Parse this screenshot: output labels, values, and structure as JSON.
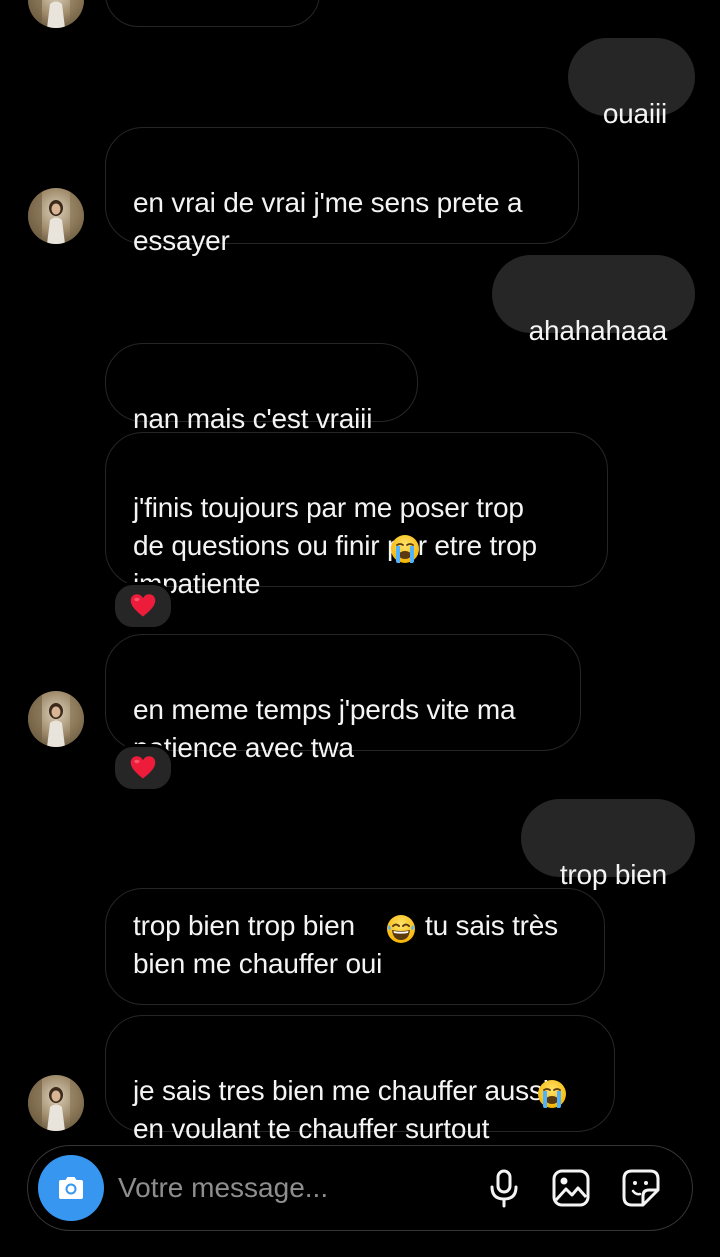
{
  "messages": [
    {
      "side": "out",
      "text": "ouaiii"
    },
    {
      "side": "in",
      "text": "en vrai de vrai j'me sens prete a\nessayer"
    },
    {
      "side": "out",
      "text": "ahahahaaa"
    },
    {
      "side": "in",
      "text": "nan mais c'est vraiii"
    },
    {
      "side": "in",
      "text": "j'finis toujours par me poser trop\nde questions ou finir par etre trop\nimpatiente",
      "emoji": "crying-face",
      "reaction": "❤️"
    },
    {
      "side": "in",
      "text": "en meme temps j'perds vite ma\npatience avec twa",
      "reaction": "❤️"
    },
    {
      "side": "out",
      "text": "trop bien"
    },
    {
      "side": "in",
      "text_a": "trop bien trop bien",
      "emoji": "laughing-face",
      "text_b": "tu sais très\nbien me chauffer oui"
    },
    {
      "side": "in",
      "text": "je sais tres bien me chauffer aussi\nen voulant te chauffer surtout",
      "emoji": "crying-face"
    }
  ],
  "composer": {
    "placeholder": "Votre message...",
    "icons": [
      "camera-icon",
      "microphone-icon",
      "gallery-icon",
      "sticker-icon"
    ]
  },
  "colors": {
    "background": "#000000",
    "outgoing_bubble": "#262626",
    "incoming_border": "#262626",
    "text": "#f4f4f4",
    "placeholder": "#8e8e8e",
    "camera_button": "#3797f0",
    "heart": "#ed1c3a"
  }
}
